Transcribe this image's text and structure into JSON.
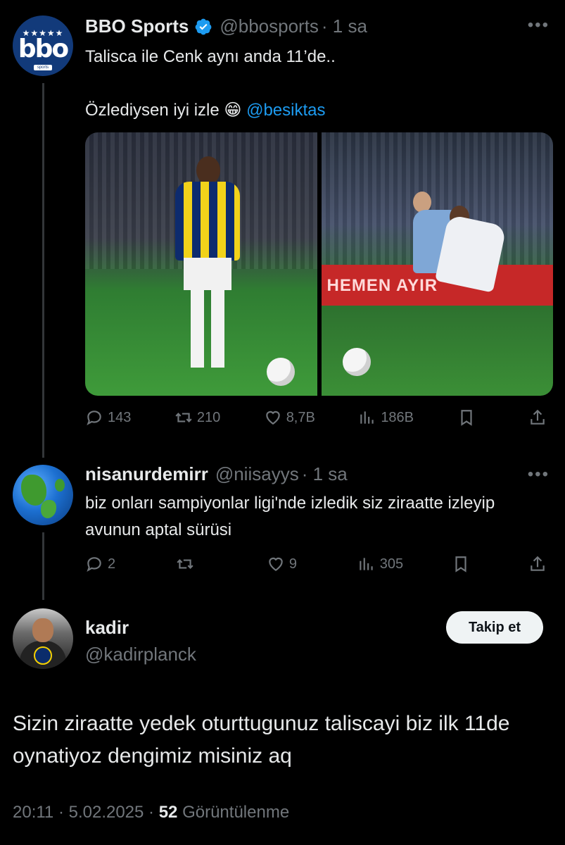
{
  "colors": {
    "background": "#000000",
    "text": "#e7e9ea",
    "muted": "#71767b",
    "link": "#1d9bf0",
    "verified": "#1d9bf0"
  },
  "tweet1": {
    "name": "BBO Sports",
    "handle": "@bbosports",
    "time": "· 1 sa",
    "avatar_text": "bbo",
    "avatar_stars": "★★★★★",
    "avatar_tag": "sports",
    "line1": "Talisca ile Cenk aynı anda 11’de..",
    "line2_text": "Özlediysen iyi izle 😁",
    "mention": "@besiktas",
    "photo2_ad_text": "HEMEN AYIR",
    "actions": {
      "replies": "143",
      "retweets": "210",
      "likes": "8,7B",
      "views": "186B"
    }
  },
  "tweet2": {
    "name": "nisanurdemirr",
    "handle": "@niisayys",
    "time": "· 1 sa",
    "text": "biz onları sampiyonlar ligi'nde izledik siz ziraatte izleyip avunun aptal sürüsi",
    "actions": {
      "replies": "2",
      "retweets": "",
      "likes": "9",
      "views": "305"
    }
  },
  "tweet3": {
    "name": "kadir",
    "handle": "@kadirplanck",
    "follow_label": "Takip et",
    "text": "Sizin ziraatte yedek oturttugunuz taliscayi biz ilk 11de oynatiyoz dengimiz misiniz aq",
    "time": "20:11 · 5.02.2025 · ",
    "views_count": "52",
    "views_label": " Görüntülenme"
  },
  "icons": [
    "reply-icon",
    "retweet-icon",
    "like-icon",
    "views-icon",
    "bookmark-icon",
    "share-icon",
    "more-icon",
    "verified-icon"
  ]
}
